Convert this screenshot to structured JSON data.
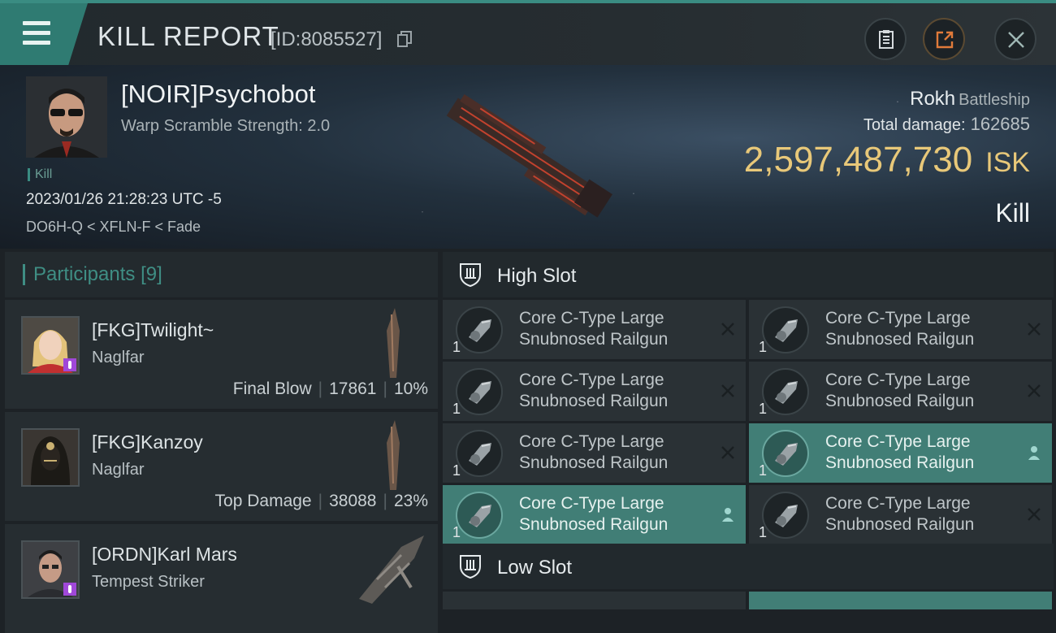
{
  "header": {
    "title": "KILL REPORT",
    "id_text": "[ID:8085527]"
  },
  "victim": {
    "name": "[NOIR]Psychobot",
    "warp_scramble": "Warp Scramble Strength: 2.0",
    "kill_tag": "Kill",
    "datetime": "2023/01/26 21:28:23 UTC -5",
    "location": "DO6H-Q < XFLN-F < Fade",
    "ship": "Rokh",
    "ship_class": "Battleship",
    "total_damage_label": "Total damage:",
    "total_damage": "162685",
    "isk_value": "2,597,487,730",
    "isk_unit": "ISK",
    "result": "Kill"
  },
  "participants": {
    "title": "Participants",
    "count": "[9]",
    "list": [
      {
        "name": "[FKG]Twilight~",
        "ship": "Naglfar",
        "role": "Final Blow",
        "damage": "17861",
        "percent": "10%"
      },
      {
        "name": "[FKG]Kanzoy",
        "ship": "Naglfar",
        "role": "Top Damage",
        "damage": "38088",
        "percent": "23%"
      },
      {
        "name": "[ORDN]Karl Mars",
        "ship": "Tempest Striker"
      }
    ]
  },
  "slots": {
    "high_label": "High Slot",
    "low_label": "Low Slot",
    "high_modules": [
      {
        "line1": "Core C-Type Large",
        "line2": "Snubnosed Railgun",
        "qty": "1",
        "state": "destroyed"
      },
      {
        "line1": "Core C-Type Large",
        "line2": "Snubnosed Railgun",
        "qty": "1",
        "state": "destroyed"
      },
      {
        "line1": "Core C-Type Large",
        "line2": "Snubnosed Railgun",
        "qty": "1",
        "state": "destroyed"
      },
      {
        "line1": "Core C-Type Large",
        "line2": "Snubnosed Railgun",
        "qty": "1",
        "state": "destroyed"
      },
      {
        "line1": "Core C-Type Large",
        "line2": "Snubnosed Railgun",
        "qty": "1",
        "state": "destroyed"
      },
      {
        "line1": "Core C-Type Large",
        "line2": "Snubnosed Railgun",
        "qty": "1",
        "state": "dropped"
      },
      {
        "line1": "Core C-Type Large",
        "line2": "Snubnosed Railgun",
        "qty": "1",
        "state": "dropped"
      },
      {
        "line1": "Core C-Type Large",
        "line2": "Snubnosed Railgun",
        "qty": "1",
        "state": "destroyed"
      }
    ]
  },
  "icons": {
    "menu": "menu-icon",
    "copy": "copy-icon",
    "clipboard": "clipboard-icon",
    "share": "share-icon",
    "close": "close-icon",
    "slot": "slot-icon",
    "destroyed": "x-icon",
    "dropped": "person-icon"
  },
  "colors": {
    "accent": "#3a8c82",
    "isk": "#e8c879",
    "fitted": "#417e76",
    "badge": "#a048d8"
  }
}
